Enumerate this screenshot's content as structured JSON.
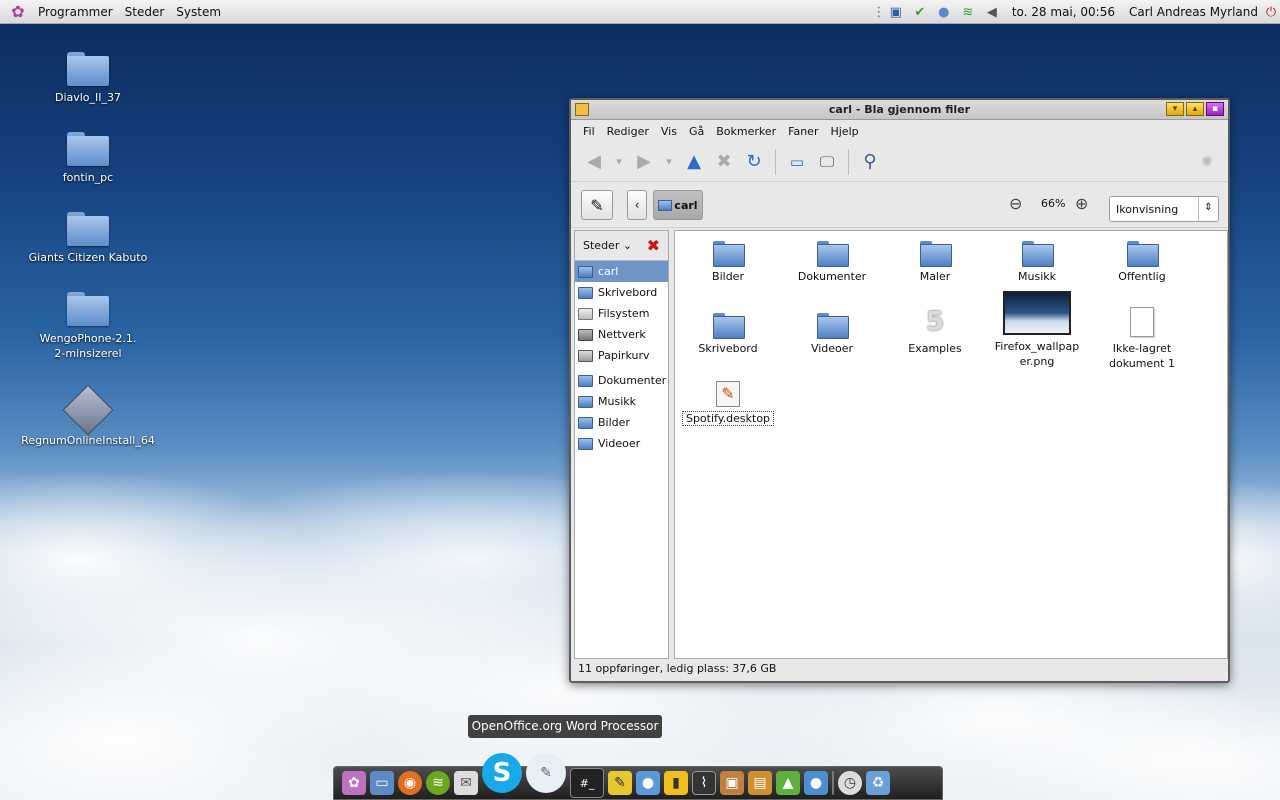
{
  "panel": {
    "menus": [
      "Programmer",
      "Steder",
      "System"
    ],
    "clock": "to. 28 mai, 00:56",
    "user": "Carl Andreas Myrland"
  },
  "desktop": {
    "icons": [
      "Diavlo_II_37",
      "fontin_pc",
      "Giants Citizen Kabuto",
      "WengoPhone-2.1.2-minsizerel",
      "RegnumOnlineInstall_64"
    ]
  },
  "window": {
    "title": "carl - Bla gjennom filer",
    "menus": [
      "Fil",
      "Rediger",
      "Vis",
      "Gå",
      "Bokmerker",
      "Faner",
      "Hjelp"
    ],
    "path": "carl",
    "zoom": "66%",
    "view_mode": "Ikonvisning",
    "sidebar": {
      "header": "Steder",
      "places": [
        "carl",
        "Skrivebord",
        "Filsystem",
        "Nettverk",
        "Papirkurv"
      ],
      "bookmarks": [
        "Dokumenter",
        "Musikk",
        "Bilder",
        "Videoer"
      ]
    },
    "files": [
      "Bilder",
      "Dokumenter",
      "Maler",
      "Musikk",
      "Offentlig",
      "Skrivebord",
      "Videoer",
      "Examples",
      "Firefox_wallpaper.png",
      "Ikke-lagret dokument 1",
      "Spotify.desktop"
    ],
    "status": "11 oppføringer, ledig plass: 37,6 GB"
  },
  "tooltip": "OpenOffice.org Word Processor",
  "colors": {
    "selection": "#6f95c8",
    "accent": "#2c6ad0",
    "close": "#d01010"
  }
}
